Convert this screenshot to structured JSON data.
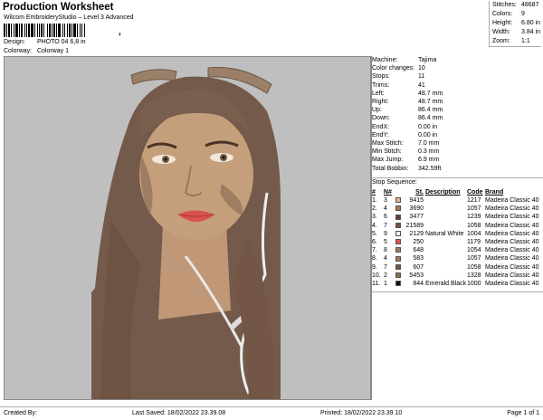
{
  "header": {
    "title": "Production Worksheet",
    "subtitle": "Wilcom EmbroideryStudio – Level 3 Advanced",
    "barcode_tail": ",",
    "design_label": "Design:",
    "design_value": "PHOTO 04 6,8 in",
    "colorway_label": "Colorway:",
    "colorway_value": "Colorway 1"
  },
  "stats": [
    {
      "label": "Stitches:",
      "value": "48687"
    },
    {
      "label": "Colors:",
      "value": "9"
    },
    {
      "label": "Height:",
      "value": "6.80 in"
    },
    {
      "label": "Width:",
      "value": "3.84 in"
    },
    {
      "label": "Zoom:",
      "value": "1:1"
    }
  ],
  "properties": [
    {
      "label": "Machine:",
      "value": "Tajima"
    },
    {
      "label": "Color changes:",
      "value": "10"
    },
    {
      "label": "Stops:",
      "value": "11"
    },
    {
      "label": "Trims:",
      "value": "41"
    },
    {
      "label": "Left:",
      "value": "48.7 mm"
    },
    {
      "label": "Right:",
      "value": "48.7 mm"
    },
    {
      "label": "Up:",
      "value": "86.4 mm"
    },
    {
      "label": "Down:",
      "value": "86.4 mm"
    },
    {
      "label": "EndX:",
      "value": "0.00 in"
    },
    {
      "label": "EndY:",
      "value": "0.00 in"
    },
    {
      "label": "Max Stitch:",
      "value": "7.0 mm"
    },
    {
      "label": "Min Stitch:",
      "value": "0.3 mm"
    },
    {
      "label": "Max Jump:",
      "value": "6.9 mm"
    },
    {
      "label": "Total Bobbin:",
      "value": "342.59ft"
    }
  ],
  "stop_sequence": {
    "title": "Stop Sequence:",
    "headers": {
      "num": "#",
      "n": "N#",
      "st": "St.",
      "desc": "Description",
      "code": "Code",
      "brand": "Brand"
    },
    "rows": [
      {
        "num": "1.",
        "n": "3",
        "color": "#e2b28c",
        "st": "9415",
        "desc": "",
        "code": "1217",
        "brand": "Madeira Classic 40"
      },
      {
        "num": "2.",
        "n": "4",
        "color": "#a07a5c",
        "st": "3690",
        "desc": "",
        "code": "1057",
        "brand": "Madeira Classic 40"
      },
      {
        "num": "3.",
        "n": "6",
        "color": "#5b3f30",
        "st": "3477",
        "desc": "",
        "code": "1239",
        "brand": "Madeira Classic 40"
      },
      {
        "num": "4.",
        "n": "7",
        "color": "#6f5446",
        "st": "21589",
        "desc": "",
        "code": "1058",
        "brand": "Madeira Classic 40"
      },
      {
        "num": "5.",
        "n": "9",
        "color": "#eeeeee",
        "st": "2129",
        "desc": "Natural White",
        "code": "1004",
        "brand": "Madeira Classic 40"
      },
      {
        "num": "6.",
        "n": "5",
        "color": "#d8524e",
        "st": "250",
        "desc": "",
        "code": "1179",
        "brand": "Madeira Classic 40"
      },
      {
        "num": "7.",
        "n": "8",
        "color": "#9a7e68",
        "st": "648",
        "desc": "",
        "code": "1054",
        "brand": "Madeira Classic 40"
      },
      {
        "num": "8.",
        "n": "4",
        "color": "#a07a5c",
        "st": "583",
        "desc": "",
        "code": "1057",
        "brand": "Madeira Classic 40"
      },
      {
        "num": "9.",
        "n": "7",
        "color": "#6f5446",
        "st": "607",
        "desc": "",
        "code": "1058",
        "brand": "Madeira Classic 40"
      },
      {
        "num": "10.",
        "n": "2",
        "color": "#8a6f50",
        "st": "5453",
        "desc": "",
        "code": "1328",
        "brand": "Madeira Classic 40"
      },
      {
        "num": "11.",
        "n": "1",
        "color": "#111111",
        "st": "844",
        "desc": "Emerald Black",
        "code": "1000",
        "brand": "Madeira Classic 40"
      }
    ]
  },
  "footer": {
    "created_by": "Created By:",
    "last_saved": "Last Saved: 18/02/2022 23.39.08",
    "printed": "Printed: 18/02/2022 23.39.10",
    "page": "Page 1 of 1"
  }
}
